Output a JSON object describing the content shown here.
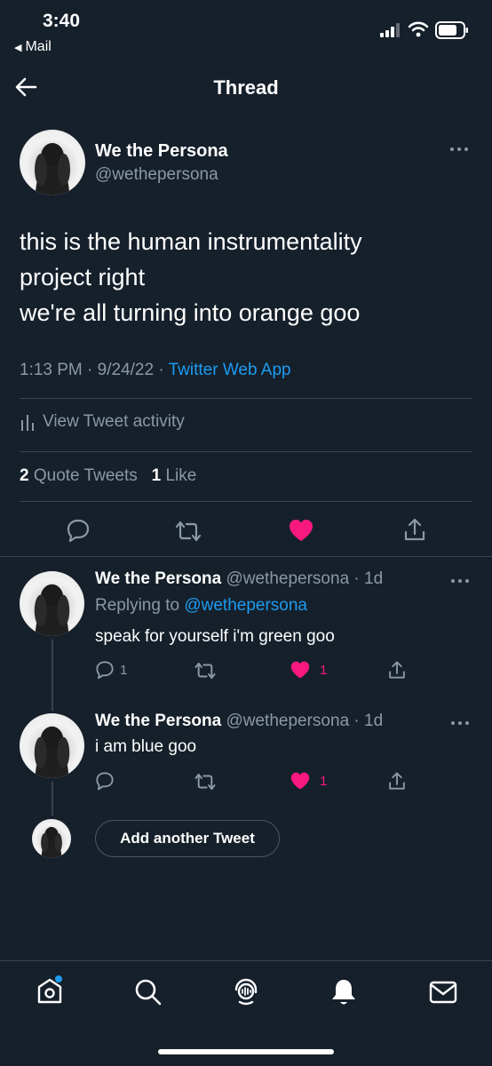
{
  "status_bar": {
    "time": "3:40",
    "back_app": "Mail"
  },
  "header": {
    "title": "Thread"
  },
  "main_tweet": {
    "name": "We the Persona",
    "handle": "@wethepersona",
    "text_lines": [
      "this is the human instrumentality",
      "project right",
      "we're all turning into orange goo"
    ],
    "time": "1:13 PM",
    "date": "9/24/22",
    "source": "Twitter Web App",
    "activity_label": "View Tweet activity",
    "quote_count": "2",
    "quote_label": "Quote Tweets",
    "like_count": "1",
    "like_label": "Like"
  },
  "replies": [
    {
      "name": "We the Persona",
      "handle": "@wethepersona",
      "age": "1d",
      "replying_prefix": "Replying to",
      "replying_to": "@wethepersona",
      "text": "speak for yourself i'm green goo",
      "reply_count": "1",
      "like_count": "1"
    },
    {
      "name": "We the Persona",
      "handle": "@wethepersona",
      "age": "1d",
      "text": "i am blue goo",
      "like_count": "1"
    }
  ],
  "compose": {
    "button_label": "Add another Tweet"
  },
  "colors": {
    "background": "#15202b",
    "accent": "#1d9bf0",
    "like": "#f91880",
    "muted": "#8b98a5",
    "divider": "#38444d"
  },
  "icons": {
    "back": "arrow-left-icon",
    "more": "more-horizontal-icon",
    "reply": "reply-bubble-icon",
    "retweet": "retweet-icon",
    "like": "heart-filled-icon",
    "share": "share-icon",
    "nav": [
      "home-icon",
      "search-icon",
      "spaces-icon",
      "notifications-icon",
      "messages-icon"
    ]
  }
}
